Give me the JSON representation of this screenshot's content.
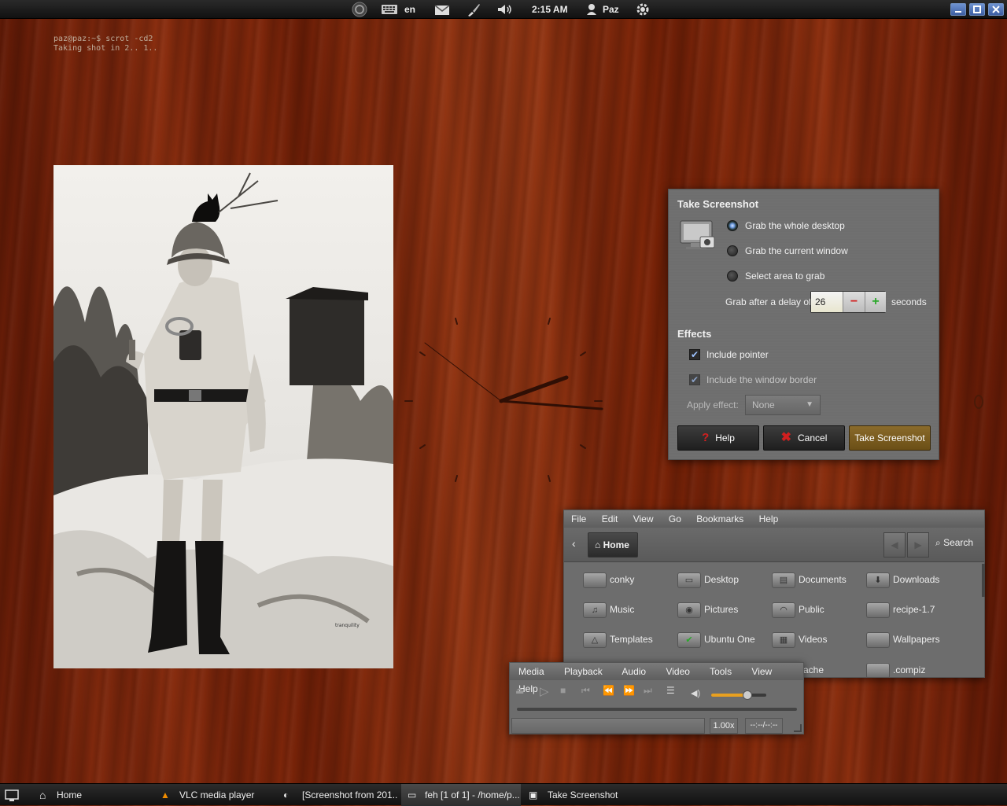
{
  "top_panel": {
    "language": "en",
    "time": "2:15 AM",
    "user": "Paz",
    "icons": [
      "ubuntu-logo-icon",
      "keyboard-icon",
      "mail-icon",
      "brush-icon",
      "volume-icon",
      "user-icon",
      "gear-icon"
    ]
  },
  "terminal": {
    "line1": "paz@paz:~$ scrot -cd2",
    "line2": "Taking shot in 2.. 1.."
  },
  "photo": {
    "watermark": "tranquility"
  },
  "screenshot_dialog": {
    "title": "Take Screenshot",
    "options": [
      "Grab the whole desktop",
      "Grab the current window",
      "Select area to grab"
    ],
    "selected_option": "Grab the whole desktop",
    "delay_label": "Grab after a delay of",
    "delay_value": "26",
    "delay_unit": "seconds",
    "effects_heading": "Effects",
    "include_pointer": "Include pointer",
    "include_border": "Include the window border",
    "apply_effect_label": "Apply effect:",
    "apply_effect_value": "None",
    "help_button": "Help",
    "cancel_button": "Cancel",
    "take_button": "Take Screenshot"
  },
  "file_manager": {
    "menu": [
      "File",
      "Edit",
      "View",
      "Go",
      "Bookmarks",
      "Help"
    ],
    "location": "Home",
    "search": "Search",
    "items": [
      "conky",
      "Desktop",
      "Documents",
      "Downloads",
      "Music",
      "Pictures",
      "Public",
      "recipe-1.7",
      "Templates",
      "Ubuntu One",
      "Videos",
      "Wallpapers",
      "ache",
      ".compiz"
    ]
  },
  "vlc": {
    "menu": [
      "Media",
      "Playback",
      "Audio",
      "Video",
      "Tools",
      "View",
      "Help"
    ],
    "speed": "1.00x",
    "time": "--:--/--:--",
    "volume_level": 0.65
  },
  "taskbar": {
    "tasks": [
      "Home",
      "VLC media player",
      "[Screenshot from 201...",
      "feh [1 of 1] - /home/p...",
      "Take Screenshot"
    ],
    "active_task": "feh [1 of 1] - /home/p..."
  },
  "colors": {
    "accent": "#6e9ce0",
    "take_button": "#7a5a1c",
    "cancel_icon": "#d21f1f",
    "plus_icon": "#29a829"
  }
}
